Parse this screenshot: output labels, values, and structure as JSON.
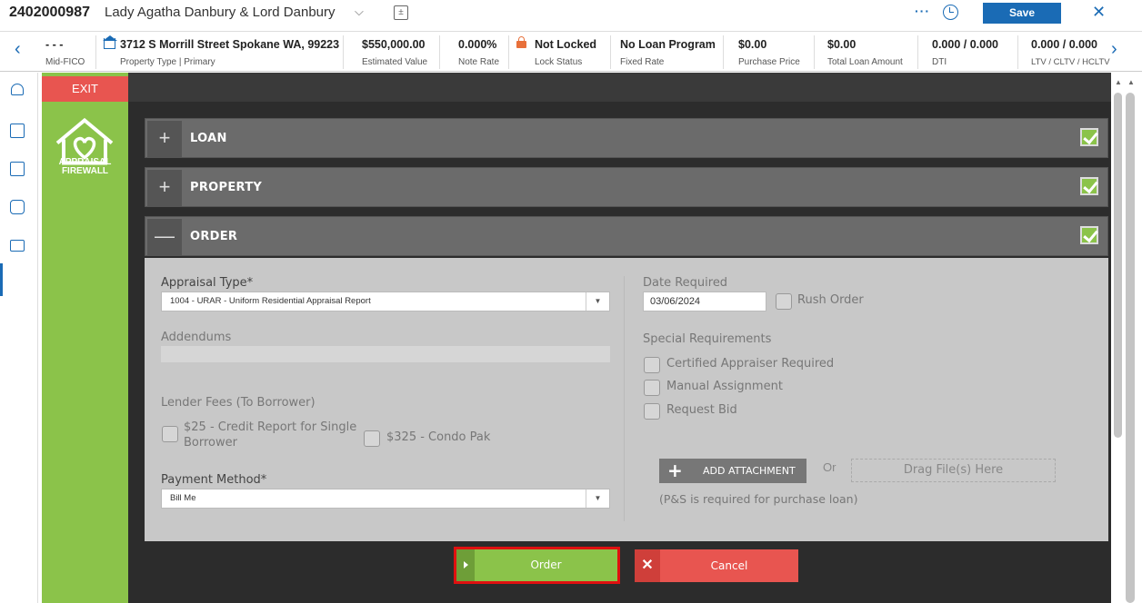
{
  "header": {
    "loan_number": "2402000987",
    "borrower_name": "Lady Agatha Danbury & Lord Danbury",
    "save_label": "Save",
    "more_label": "···"
  },
  "summary": [
    {
      "value": "- - -",
      "label": "Mid-FICO"
    },
    {
      "value": "3712 S Morrill Street Spokane WA, 99223",
      "label": "Property Type | Primary"
    },
    {
      "value": "$550,000.00",
      "label": "Estimated Value"
    },
    {
      "value": "0.000%",
      "label": "Note Rate"
    },
    {
      "value": "Not Locked",
      "label": "Lock Status"
    },
    {
      "value": "No Loan Program",
      "label": "Fixed Rate"
    },
    {
      "value": "$0.00",
      "label": "Purchase Price"
    },
    {
      "value": "$0.00",
      "label": "Total Loan Amount"
    },
    {
      "value": "0.000 / 0.000",
      "label": "DTI"
    },
    {
      "value": "0.000 / 0.000",
      "label": "LTV / CLTV / HCLTV"
    }
  ],
  "sidepanel": {
    "exit_label": "EXIT",
    "logo_line1": "APPRAISAL",
    "logo_line2": "FIREWALL"
  },
  "sections": [
    {
      "title": "LOAN",
      "toggle": "+"
    },
    {
      "title": "PROPERTY",
      "toggle": "+"
    },
    {
      "title": "ORDER",
      "toggle": "—"
    }
  ],
  "order": {
    "appraisal_type_label": "Appraisal Type*",
    "appraisal_type_value": "1004 - URAR - Uniform Residential Appraisal Report",
    "addendums_label": "Addendums",
    "lender_fees_label": "Lender Fees (To Borrower)",
    "fee1_label_line1": "$25 - Credit Report for Single",
    "fee1_label_line2": "Borrower",
    "fee2_label": "$325 - Condo Pak",
    "payment_method_label": "Payment Method*",
    "payment_method_value": "Bill Me",
    "date_required_label": "Date Required",
    "date_required_value": "03/06/2024",
    "rush_order_label": "Rush Order",
    "special_req_label": "Special Requirements",
    "special_req_options": [
      "Certified Appraiser Required",
      "Manual Assignment",
      "Request Bid"
    ],
    "add_attachment_label": "ADD ATTACHMENT",
    "or_label": "Or",
    "dropzone_label": "Drag File(s) Here",
    "note": "(P&S is required for purchase loan)"
  },
  "footer": {
    "order_label": "Order",
    "cancel_label": "Cancel"
  },
  "colors": {
    "accent": "#1a6bb5",
    "green": "#8bc34a",
    "red": "#e85550",
    "highlight": "#e01010"
  }
}
